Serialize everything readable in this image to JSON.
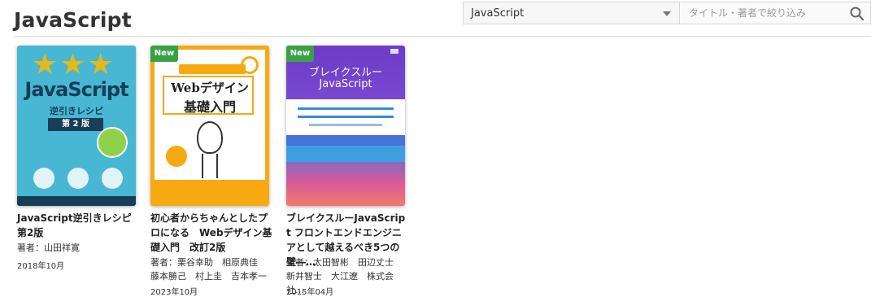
{
  "header": {
    "title": "JavaScript",
    "category_select": {
      "value": "JavaScript"
    },
    "search": {
      "placeholder": "タイトル・著者で絞り込み"
    }
  },
  "books": [
    {
      "title": "JavaScript逆引きレシピ 第2版",
      "author": "著者：山田祥寛",
      "date": "2018年10月",
      "is_new": false,
      "cover": {
        "title": "JavaScript",
        "subtitle": "逆引きレシピ",
        "edition": "第 2 版",
        "colors": {
          "bg": "#48b7d4",
          "accent": "#e5b91a",
          "dark": "#163e55"
        }
      }
    },
    {
      "title": "初心者からちゃんとしたプロになる　Webデザイン基礎入門　改訂2版",
      "author": "著者：栗谷幸助　相原典佳　藤本勝己　村上圭　吉本孝一",
      "date": "2023年10月",
      "is_new": true,
      "badge": "New",
      "cover": {
        "title_line1": "Webデザイン",
        "title_line2": "基礎入門",
        "colors": {
          "bg": "#f7a912",
          "panel": "#ffffff"
        }
      }
    },
    {
      "title": "ブレイクスルーJavaScript フロントエンドエンジニアとして越えるべき5つの壁―…",
      "author": "著者：太田智彬　田辺丈士　新井智士　大江遼　株式会社…",
      "date": "2015年04月",
      "is_new": true,
      "badge": "New",
      "cover": {
        "title_line1": "ブレイクスルー",
        "title_line2": "JavaScript",
        "colors": {
          "top": "#6c3cc8",
          "mid": "#3e7ad8",
          "bottom": "#f07a6a"
        }
      }
    }
  ]
}
